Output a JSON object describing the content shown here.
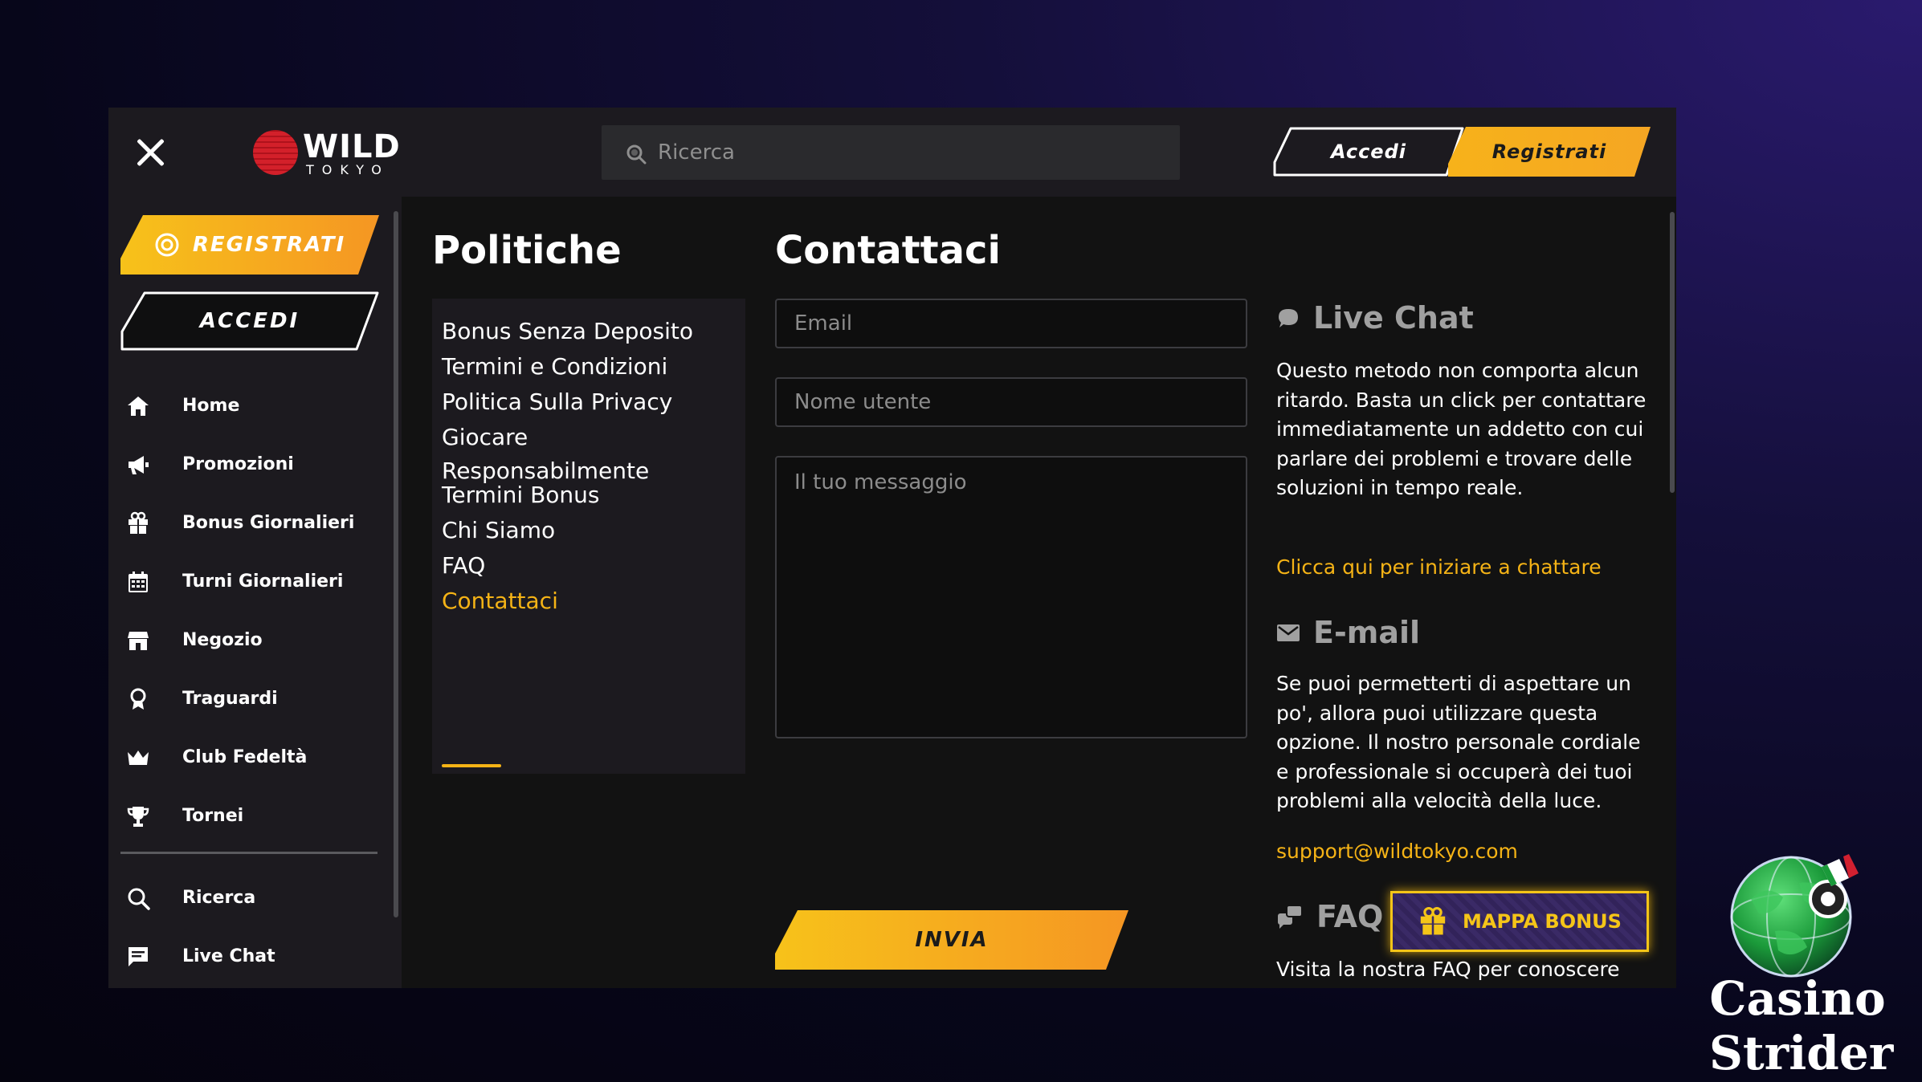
{
  "header": {
    "close_icon": "close-icon",
    "logo_word": "WILD",
    "logo_sub": "TOKYO",
    "search_placeholder": "Ricerca",
    "login_label": "Accedi",
    "register_label": "Registrati"
  },
  "sidebar": {
    "register_label": "REGISTRATI",
    "login_label": "ACCEDI",
    "items": [
      {
        "label": "Home",
        "icon": "home-icon"
      },
      {
        "label": "Promozioni",
        "icon": "megaphone-icon"
      },
      {
        "label": "Bonus Giornalieri",
        "icon": "gift-icon"
      },
      {
        "label": "Turni Giornalieri",
        "icon": "calendar-icon"
      },
      {
        "label": "Negozio",
        "icon": "store-icon"
      },
      {
        "label": "Traguardi",
        "icon": "award-icon"
      },
      {
        "label": "Club Fedeltà",
        "icon": "crown-icon"
      },
      {
        "label": "Tornei",
        "icon": "trophy-icon"
      }
    ],
    "bottom_items": [
      {
        "label": "Ricerca",
        "icon": "search-icon"
      },
      {
        "label": "Live Chat",
        "icon": "chat-icon"
      }
    ]
  },
  "policies": {
    "title": "Politiche",
    "items": [
      "Bonus Senza Deposito",
      "Termini e Condizioni",
      "Politica Sulla Privacy",
      "Giocare Responsabilmente",
      "Termini Bonus",
      "Chi Siamo",
      "FAQ",
      "Contattaci"
    ],
    "active": "Contattaci"
  },
  "contact": {
    "title": "Contattaci",
    "email_placeholder": "Email",
    "username_placeholder": "Nome utente",
    "message_placeholder": "Il tuo messaggio",
    "submit_label": "INVIA"
  },
  "info": {
    "live_chat_title": "Live Chat",
    "live_chat_text": "Questo metodo non comporta alcun ritardo. Basta un click per contattare immediatamente un addetto con cui parlare dei problemi e trovare delle soluzioni in tempo reale.",
    "live_chat_link": "Clicca qui per iniziare a chattare",
    "email_title": "E-mail",
    "email_text": "Se puoi permetterti di aspettare un po', allora puoi utilizzare questa opzione. Il nostro personale cordiale e professionale si occuperà dei tuoi problemi alla velocità della luce.",
    "email_link": "support@wildtokyo.com",
    "faq_title": "FAQ",
    "faq_text": "Visita la nostra FAQ per conoscere",
    "bonus_map_label": "MAPPA BONUS"
  },
  "watermark": {
    "line1": "Casino",
    "line2": "Strider"
  },
  "colors": {
    "accent": "#f5b316",
    "panel": "#1c1a1f",
    "background": "#121212"
  }
}
